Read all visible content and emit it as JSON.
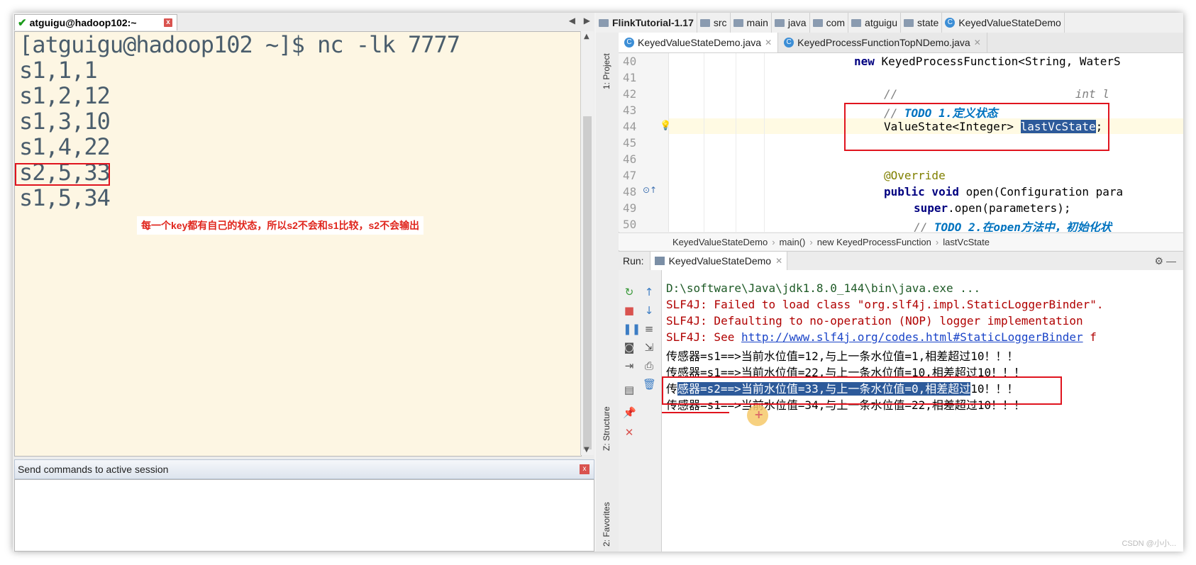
{
  "terminal": {
    "tab_title": "atguigu@hadoop102:~",
    "close_label": "x",
    "nav_left": "◀",
    "nav_right": "▶",
    "lines": [
      "[atguigu@hadoop102 ~]$ nc -lk 7777",
      "s1,1,1",
      "s1,2,12",
      "s1,3,10",
      "s1,4,22",
      "s2,5,33",
      "s1,5,34"
    ],
    "annotation": "每一个key都有自己的状态，所以s2不会和s1比较，s2不会输出",
    "command_bar_label": "Send commands to active session",
    "command_close_label": "x"
  },
  "ide": {
    "breadcrumb": [
      "FlinkTutorial-1.17",
      "src",
      "main",
      "java",
      "com",
      "atguigu",
      "state",
      "KeyedValueStateDemo"
    ],
    "file_tabs": [
      {
        "label": "KeyedValueStateDemo.java",
        "active": true
      },
      {
        "label": "KeyedProcessFunctionTopNDemo.java",
        "active": false
      }
    ],
    "side_labels": {
      "project": "1: Project",
      "structure": "Z: Structure",
      "favorites": "2: Favorites"
    },
    "line_numbers": [
      "40",
      "41",
      "42",
      "43",
      "44",
      "45",
      "46",
      "47",
      "48",
      "49",
      "50"
    ],
    "code": {
      "l40a": "new",
      "l40b": " KeyedProcessFunction<String, WaterS",
      "l42": "//                          int l",
      "l43a": "// ",
      "l43b": "TODO 1.定义状态",
      "l44a": "ValueState<Integer> ",
      "l44b": "lastVcState",
      "l44c": ";",
      "l47": "@Override",
      "l48a": "public void",
      "l48b": " open(Configuration para",
      "l49a": "super",
      "l49b": ".open(parameters);",
      "l50a": "// ",
      "l50b": "TODO 2.在open方法中，初始化状"
    },
    "nav_path": [
      "KeyedValueStateDemo",
      "main()",
      "new KeyedProcessFunction",
      "lastVcState"
    ],
    "run_label": "Run:",
    "run_tab": "KeyedValueStateDemo",
    "console": {
      "l1": "D:\\software\\Java\\jdk1.8.0_144\\bin\\java.exe ...",
      "l2": "SLF4J: Failed to load class \"org.slf4j.impl.StaticLoggerBinder\".",
      "l3": "SLF4J: Defaulting to no-operation (NOP) logger implementation",
      "l4a": "SLF4J: See ",
      "l4b": "http://www.slf4j.org/codes.html#StaticLoggerBinder",
      "l4c": " f",
      "l5": "传感器=s1==>当前水位值=12,与上一条水位值=1,相差超过10！！！",
      "l6": "传感器=s1==>当前水位值=22,与上一条水位值=10,相差超过10！！！",
      "l7a": "传",
      "l7b": "感器=s2==>当前水位值=33,与上一条水位值=0,相差超过",
      "l7c": "10！！！",
      "l8": "传感器=s1==>当前水位值=34,与上一条水位值=22,相差超过10！！！"
    },
    "cursor_plus": "+",
    "watermark": "CSDN @小小..."
  }
}
